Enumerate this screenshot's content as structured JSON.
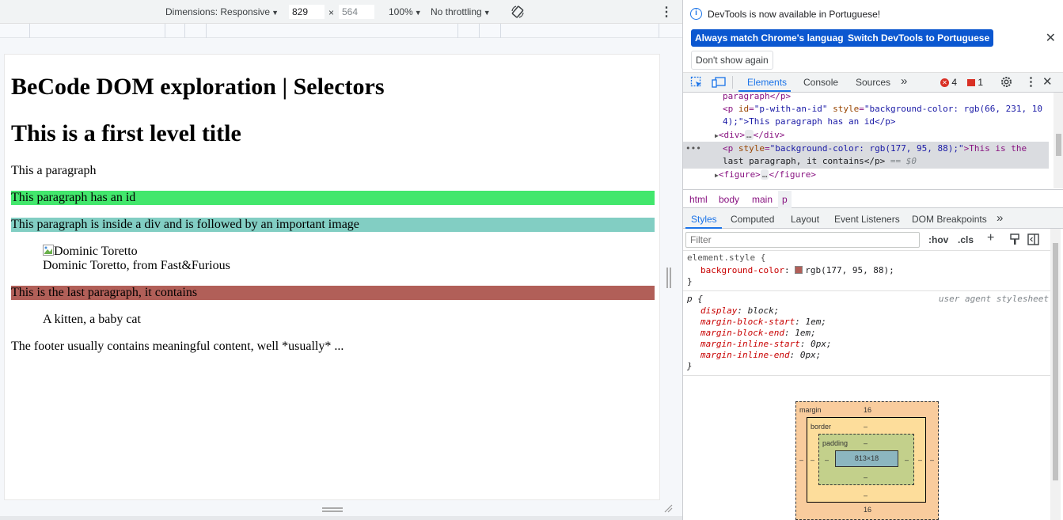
{
  "device_toolbar": {
    "dimensions_label": "Dimensions: Responsive",
    "width_value": "829",
    "times": "×",
    "height_value": "564",
    "zoom": "100%",
    "throttling": "No throttling"
  },
  "page": {
    "title": "BeCode DOM exploration | Selectors",
    "h1": "This is a first level title",
    "p1": "This a paragraph",
    "p_with_id": "This paragraph has an id",
    "p_div": "This paragraph is inside a div and is followed by an important image",
    "img_alt": "Dominic Toretto",
    "figcaption1": "Dominic Toretto, from Fast&Furious",
    "p_last": "This is the last paragraph, it contains",
    "figcaption2": "A kitten, a baby cat",
    "footer": "The footer usually contains meaningful content, well *usually* ...",
    "colors": {
      "green": "#42e76c",
      "teal": "#82cec3",
      "red": "#b15f58"
    }
  },
  "devtools": {
    "info_text": "DevTools is now available in Portuguese!",
    "btn_match": "Always match Chrome's language",
    "btn_switch": "Switch DevTools to Portuguese",
    "btn_dont_show": "Don't show again",
    "tabs": [
      "Elements",
      "Console",
      "Sources"
    ],
    "more_tabs": "»",
    "error_count": "4",
    "warning_count": "1",
    "dom": {
      "line0": "paragraph</p>",
      "line1_open": "<p ",
      "line1_attr1": "id",
      "line1_val1": "\"p-with-an-id\"",
      "line1_attr2": "style",
      "line1_val2": "\"background-color: rgb(66, 231, 10",
      "line2": "4);\">This paragraph has an id</p>",
      "line3": "<div>",
      "line3_end": "</div>",
      "line4_open": "<p ",
      "line4_attr": "style",
      "line4_val": "\"background-color: rgb(177, 95, 88);\"",
      "line4_text": ">This is the",
      "line5": "last paragraph, it contains</p>",
      "line5_eq": " == $0",
      "line6": "<figure>",
      "line6_end": "</figure>",
      "ellipsis": "…",
      "row_dots": "•••"
    },
    "breadcrumbs": [
      "html",
      "body",
      "main",
      "p"
    ],
    "sub_tabs": [
      "Styles",
      "Computed",
      "Layout",
      "Event Listeners",
      "DOM Breakpoints"
    ],
    "filter_placeholder": "Filter",
    "hov": ":hov",
    "cls": ".cls",
    "styles": {
      "element_selector": "element.style {",
      "element_prop": "background-color",
      "element_val": "rgb(177, 95, 88);",
      "element_swatch": "#b15f58",
      "close": "}",
      "p_selector": "p {",
      "ua_label": "user agent stylesheet",
      "p_props": [
        {
          "name": "display",
          "value": "block;"
        },
        {
          "name": "margin-block-start",
          "value": "1em;"
        },
        {
          "name": "margin-block-end",
          "value": "1em;"
        },
        {
          "name": "margin-inline-start",
          "value": "0px;"
        },
        {
          "name": "margin-inline-end",
          "value": "0px;"
        }
      ]
    },
    "box_model": {
      "margin_label": "margin",
      "margin_top": "16",
      "margin_bottom": "16",
      "border_label": "border",
      "padding_label": "padding",
      "dash": "–",
      "content": "813×18"
    }
  }
}
